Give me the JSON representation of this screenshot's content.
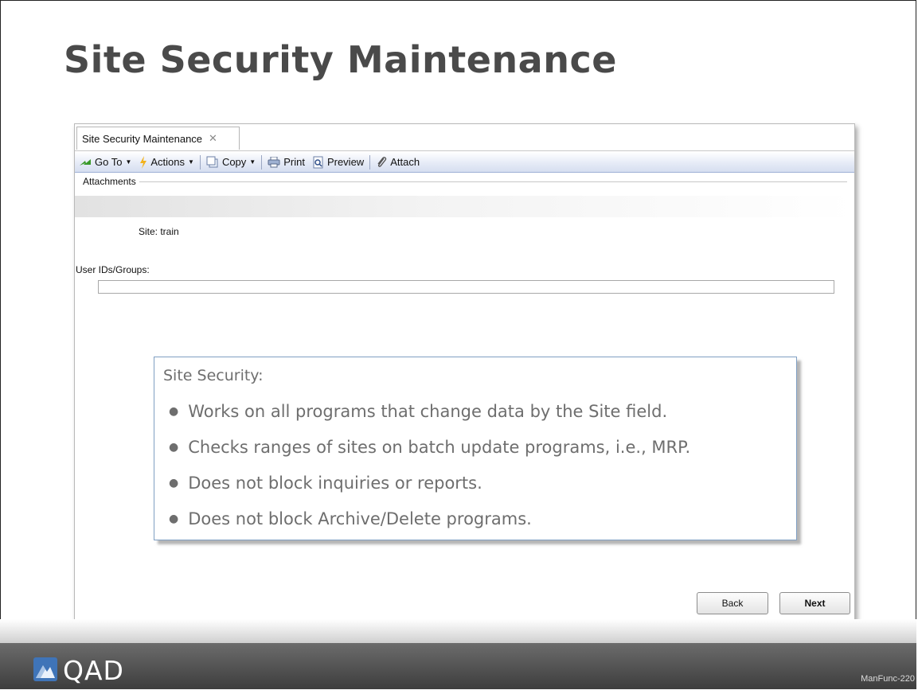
{
  "slide": {
    "title": "Site Security Maintenance",
    "code": "ManFunc-220",
    "logo_text": "QAD"
  },
  "window": {
    "tab_label": "Site Security Maintenance",
    "toolbar": {
      "goto_label": "Go To",
      "actions_label": "Actions",
      "copy_label": "Copy",
      "print_label": "Print",
      "preview_label": "Preview",
      "attach_label": "Attach"
    },
    "attachments_label": "Attachments",
    "site_text": "Site: train",
    "users_label": "User IDs/Groups:",
    "users_value": "",
    "back_label": "Back",
    "next_label": "Next"
  },
  "callout": {
    "heading": "Site Security:",
    "bullets": [
      "Works on all programs that change data by the Site field.",
      "Checks ranges of sites on batch update programs, i.e., MRP.",
      "Does not block inquiries or reports.",
      "Does not block Archive/Delete programs."
    ]
  },
  "colors": {
    "title": "#4a4a4a",
    "callout_text": "#6e6e6e",
    "callout_border": "#7f9fc3",
    "footer": "#4a4a4a"
  }
}
